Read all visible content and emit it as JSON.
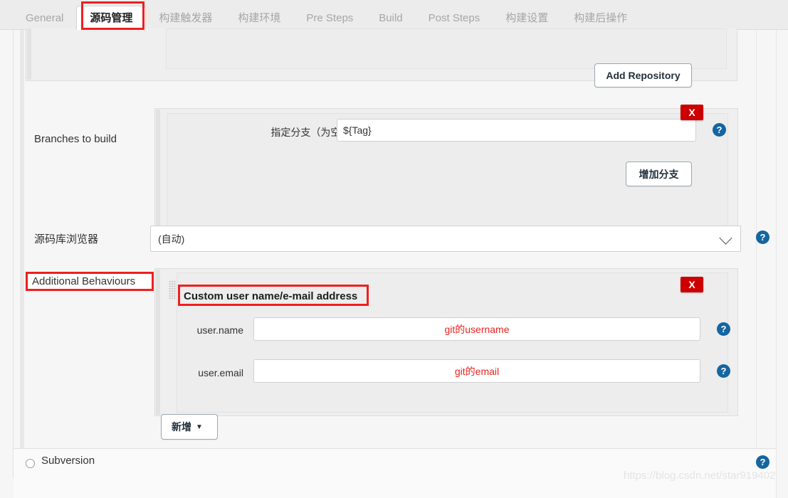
{
  "tabs": [
    {
      "label": "General",
      "active": false
    },
    {
      "label": "源码管理",
      "active": true
    },
    {
      "label": "构建触发器",
      "active": false
    },
    {
      "label": "构建环境",
      "active": false
    },
    {
      "label": "Pre Steps",
      "active": false
    },
    {
      "label": "Build",
      "active": false
    },
    {
      "label": "Post Steps",
      "active": false
    },
    {
      "label": "构建设置",
      "active": false
    },
    {
      "label": "构建后操作",
      "active": false
    }
  ],
  "repository_section": {
    "add_repository_button": "Add Repository"
  },
  "branches_section": {
    "label": "Branches to build",
    "branch_spec_label": "指定分支（为空时代表any）",
    "branch_spec_value": "${Tag}",
    "add_branch_button": "增加分支",
    "delete_button": "X",
    "help": "?"
  },
  "browser_section": {
    "label": "源码库浏览器",
    "selected_option": "(自动)",
    "options": [
      "(自动)"
    ],
    "help": "?"
  },
  "additional_behaviours": {
    "label": "Additional Behaviours",
    "block_title": "Custom user name/e-mail address",
    "delete_button": "X",
    "fields": [
      {
        "label": "user.name",
        "value": "git的username",
        "help": "?"
      },
      {
        "label": "user.email",
        "value": "git的email",
        "help": "?"
      }
    ],
    "add_button": "新增",
    "add_button_caret": "▼"
  },
  "scm_options": {
    "subversion_label": "Subversion",
    "help": "?"
  },
  "watermark": "https://blog.csdn.net/star919402",
  "colors": {
    "accent_red": "#ef1f1f",
    "delete_red": "#cc0000",
    "help_blue": "#1565a0",
    "value_red": "#e8231f",
    "tab_inactive": "#a6a6a6",
    "panel_bg": "#efefef",
    "page_bg": "#f6f6f6"
  }
}
